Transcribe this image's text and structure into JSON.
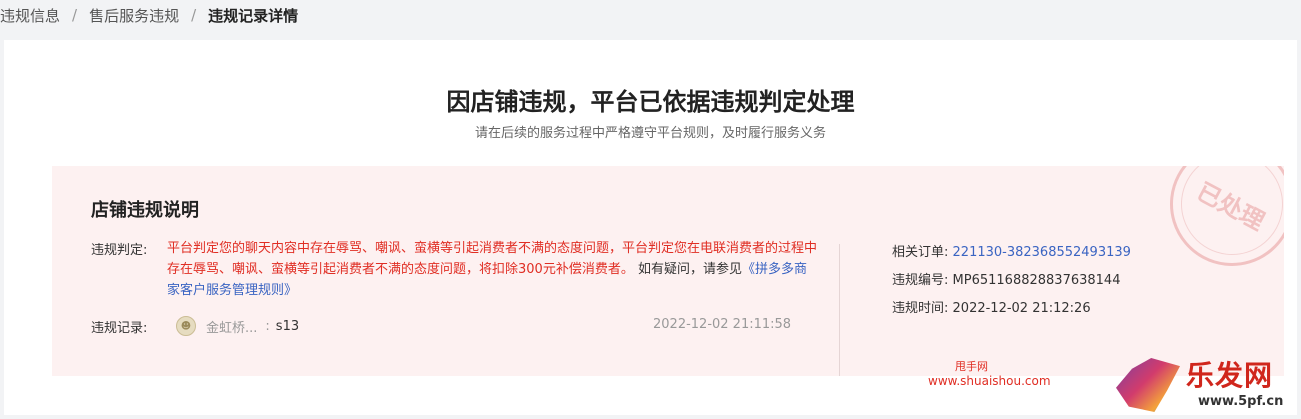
{
  "breadcrumb": {
    "items": [
      "违规信息",
      "售后服务违规",
      "违规记录详情"
    ],
    "separator": "/"
  },
  "header": {
    "title": "因店铺违规，平台已依据违规判定处理",
    "subtitle": "请在后续的服务过程中严格遵守平台规则，及时履行服务义务"
  },
  "panel": {
    "title": "店铺违规说明",
    "judgement_label": "违规判定:",
    "judgement_text": "平台判定您的聊天内容中存在辱骂、嘲讽、蛮横等引起消费者不满的态度问题，平台判定您在电联消费者的过程中存在辱骂、嘲讽、蛮横等引起消费者不满的态度问题，将扣除300元补偿消费者。",
    "judgement_tail": "如有疑问，请参见",
    "rule_link": "《拼多多商家客户服务管理规则》",
    "record_label": "违规记录:",
    "record_name": "金虹桥...",
    "record_colon": ":",
    "record_message": "s13",
    "record_time": "2022-12-02 21:11:58",
    "order_label": "相关订单:",
    "order_value": "221130-382368552493139",
    "code_label": "违规编号:",
    "code_value": "MP651168828837638144",
    "time_label": "违规时间:",
    "time_value": "2022-12-02 21:12:26",
    "stamp_text": "已处理"
  },
  "watermark": {
    "site_cn": "甩手网",
    "site_url": "www.shuaishou.com",
    "brand": "乐发网",
    "brand_url": "www.5pf.cn"
  },
  "colors": {
    "alert_red": "#e02e24",
    "link_blue": "#3a64c2",
    "panel_bg": "#fdf1f1",
    "page_bg": "#f2f3f5"
  }
}
